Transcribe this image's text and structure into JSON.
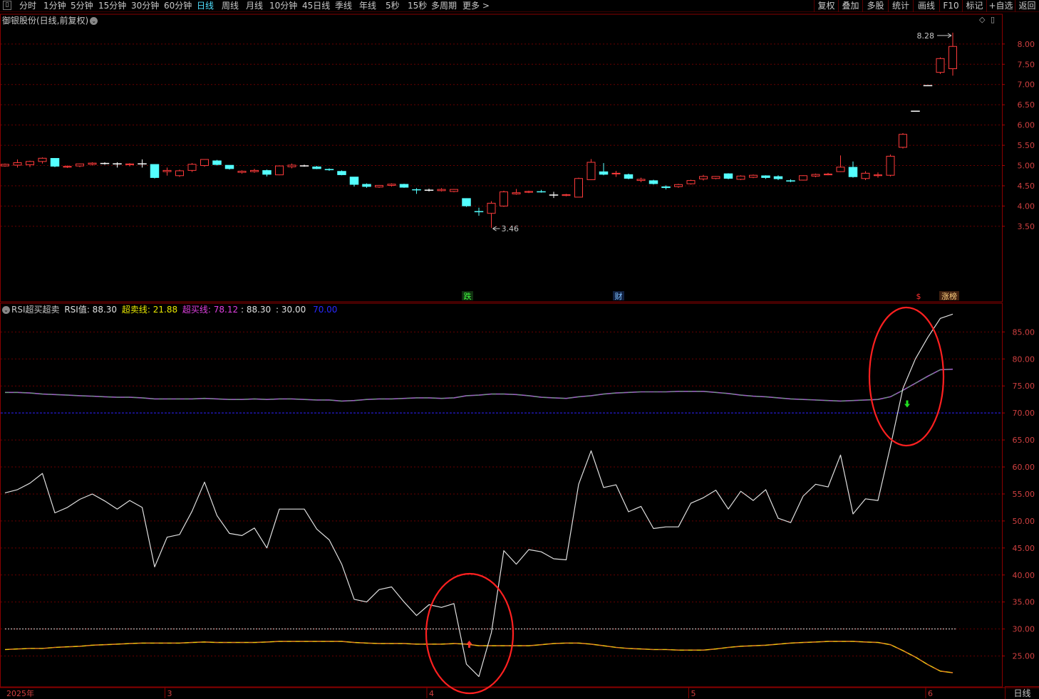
{
  "toolbar": {
    "first_icon": "▯",
    "periods": [
      "分时",
      "1分钟",
      "5分钟",
      "15分钟",
      "30分钟",
      "60分钟",
      "日线",
      "周线",
      "月线",
      "10分钟",
      "45日线",
      "季线",
      "年线",
      "5秒",
      "15秒",
      "多周期",
      "更多 >"
    ],
    "active": "日线",
    "right_buttons": [
      "复权",
      "叠加",
      "多股",
      "统计",
      "画线",
      "F10",
      "标记",
      "+自选",
      "返回"
    ]
  },
  "stock_title": "御银股份(日线,前复权)",
  "indicator": {
    "name": "RSI超买超卖",
    "rsi_label": "RSI值: 88.30",
    "oversold_label": "超卖线: 21.88",
    "overbought_label": "超买线: 78.12",
    "extra1": ": 88.30",
    "extra2": ": 30.00",
    "extra3": "70.00",
    "colors": {
      "rsi": "#e0e0e0",
      "oversold": "#e8e800",
      "overbought": "#e040e0",
      "line70": "#2020ff"
    }
  },
  "markers": {
    "fall": "跌",
    "fin": "财",
    "zt_icon": "$",
    "zt_list": "涨榜"
  },
  "period_box": "日线",
  "chart_data": [
    {
      "type": "candlestick",
      "title": "",
      "ylim": [
        3.3,
        8.4
      ],
      "yticks": [
        "8.00",
        "7.50",
        "7.00",
        "6.50",
        "6.00",
        "5.50",
        "5.00",
        "4.50",
        "4.00",
        "3.50"
      ],
      "annotations": {
        "high": "8.28",
        "low": "3.46"
      },
      "colors": {
        "up": "#ff3b3b",
        "down": "#54ffff",
        "flat": "#ffffff"
      },
      "ohlc": [
        [
          4.99,
          5.05,
          4.97,
          5.03
        ],
        [
          5.01,
          5.15,
          4.95,
          5.07
        ],
        [
          5.02,
          5.12,
          4.96,
          5.1
        ],
        [
          5.1,
          5.2,
          5.05,
          5.18
        ],
        [
          5.18,
          5.18,
          4.96,
          4.98
        ],
        [
          4.96,
          5.0,
          4.94,
          4.98
        ],
        [
          4.99,
          5.05,
          4.96,
          5.04
        ],
        [
          5.03,
          5.08,
          5.0,
          5.06
        ],
        [
          5.06,
          5.08,
          5.02,
          5.06
        ],
        [
          5.05,
          5.08,
          4.95,
          5.05
        ],
        [
          5.02,
          5.06,
          4.98,
          5.04
        ],
        [
          5.05,
          5.15,
          4.95,
          5.05
        ],
        [
          5.03,
          5.03,
          4.68,
          4.7
        ],
        [
          4.85,
          4.95,
          4.75,
          4.88
        ],
        [
          4.75,
          4.9,
          4.72,
          4.87
        ],
        [
          4.88,
          5.06,
          4.84,
          5.03
        ],
        [
          5.0,
          5.16,
          4.97,
          5.15
        ],
        [
          5.12,
          5.14,
          5.0,
          5.02
        ],
        [
          5.01,
          5.01,
          4.9,
          4.92
        ],
        [
          4.83,
          4.88,
          4.8,
          4.86
        ],
        [
          4.85,
          4.92,
          4.82,
          4.88
        ],
        [
          4.88,
          4.9,
          4.73,
          4.78
        ],
        [
          4.77,
          5.0,
          4.76,
          4.99
        ],
        [
          4.97,
          5.05,
          4.93,
          5.01
        ],
        [
          5.0,
          5.02,
          4.97,
          5.0
        ],
        [
          4.97,
          4.99,
          4.91,
          4.92
        ],
        [
          4.91,
          4.93,
          4.87,
          4.89
        ],
        [
          4.86,
          4.88,
          4.76,
          4.77
        ],
        [
          4.72,
          4.72,
          4.48,
          4.53
        ],
        [
          4.54,
          4.56,
          4.45,
          4.48
        ],
        [
          4.47,
          4.52,
          4.45,
          4.51
        ],
        [
          4.51,
          4.56,
          4.48,
          4.54
        ],
        [
          4.54,
          4.55,
          4.45,
          4.46
        ],
        [
          4.41,
          4.44,
          4.3,
          4.4
        ],
        [
          4.4,
          4.43,
          4.36,
          4.4
        ],
        [
          4.38,
          4.44,
          4.36,
          4.41
        ],
        [
          4.36,
          4.42,
          4.34,
          4.41
        ],
        [
          4.19,
          4.19,
          3.98,
          4.0
        ],
        [
          3.87,
          3.96,
          3.76,
          3.86
        ],
        [
          3.82,
          4.12,
          3.46,
          4.07
        ],
        [
          4.0,
          4.38,
          3.98,
          4.35
        ],
        [
          4.3,
          4.42,
          4.28,
          4.33
        ],
        [
          4.34,
          4.38,
          4.32,
          4.36
        ],
        [
          4.36,
          4.4,
          4.33,
          4.35
        ],
        [
          4.28,
          4.35,
          4.2,
          4.28
        ],
        [
          4.26,
          4.3,
          4.24,
          4.28
        ],
        [
          4.22,
          4.7,
          4.22,
          4.68
        ],
        [
          4.65,
          5.16,
          4.64,
          5.08
        ],
        [
          4.85,
          5.06,
          4.76,
          4.78
        ],
        [
          4.8,
          4.87,
          4.72,
          4.81
        ],
        [
          4.78,
          4.8,
          4.66,
          4.68
        ],
        [
          4.63,
          4.7,
          4.59,
          4.66
        ],
        [
          4.63,
          4.65,
          4.53,
          4.55
        ],
        [
          4.48,
          4.51,
          4.41,
          4.45
        ],
        [
          4.48,
          4.55,
          4.45,
          4.53
        ],
        [
          4.55,
          4.65,
          4.53,
          4.63
        ],
        [
          4.67,
          4.77,
          4.63,
          4.73
        ],
        [
          4.68,
          4.74,
          4.66,
          4.73
        ],
        [
          4.8,
          4.81,
          4.66,
          4.68
        ],
        [
          4.66,
          4.76,
          4.64,
          4.74
        ],
        [
          4.71,
          4.78,
          4.69,
          4.76
        ],
        [
          4.75,
          4.76,
          4.67,
          4.7
        ],
        [
          4.73,
          4.76,
          4.64,
          4.67
        ],
        [
          4.63,
          4.66,
          4.59,
          4.61
        ],
        [
          4.64,
          4.76,
          4.63,
          4.75
        ],
        [
          4.74,
          4.8,
          4.71,
          4.78
        ],
        [
          4.77,
          4.82,
          4.76,
          4.79
        ],
        [
          4.85,
          5.25,
          4.84,
          4.96
        ],
        [
          4.96,
          5.1,
          4.7,
          4.72
        ],
        [
          4.68,
          4.86,
          4.64,
          4.81
        ],
        [
          4.75,
          4.83,
          4.7,
          4.77
        ],
        [
          4.76,
          5.27,
          4.73,
          5.23
        ],
        [
          5.45,
          5.8,
          5.42,
          5.77
        ],
        [
          6.35,
          6.35,
          6.35,
          6.35
        ],
        [
          6.98,
          6.98,
          6.98,
          6.98
        ],
        [
          7.3,
          7.67,
          7.26,
          7.64
        ],
        [
          7.39,
          8.28,
          7.22,
          7.94
        ]
      ]
    },
    {
      "type": "line",
      "title": "",
      "ylim": [
        20,
        90
      ],
      "yticks": [
        "85.00",
        "80.00",
        "75.00",
        "70.00",
        "65.00",
        "60.00",
        "55.00",
        "50.00",
        "45.00",
        "40.00",
        "35.00",
        "30.00",
        "25.00"
      ],
      "x_labels": [
        "2025年",
        "3",
        "4",
        "5",
        "6"
      ],
      "series": [
        {
          "name": "RSI值",
          "values": [
            55.2,
            55.8,
            57.0,
            58.8,
            51.5,
            52.5,
            54.0,
            55.0,
            53.7,
            52.2,
            53.8,
            52.5,
            41.5,
            47.0,
            47.5,
            51.8,
            57.2,
            51.0,
            47.7,
            47.3,
            48.7,
            45.0,
            52.2,
            52.2,
            52.2,
            48.5,
            46.5,
            42.0,
            35.5,
            35.0,
            37.3,
            37.8,
            35.0,
            32.5,
            34.5,
            34.0,
            34.7,
            23.5,
            21.2,
            29.3,
            44.5,
            42.0,
            44.7,
            44.3,
            43.0,
            42.8,
            56.8,
            63.0,
            56.2,
            56.7,
            51.7,
            52.7,
            48.6,
            48.9,
            48.9,
            53.3,
            54.3,
            55.7,
            52.2,
            55.5,
            53.8,
            55.8,
            50.5,
            49.7,
            54.6,
            56.8,
            56.3,
            62.2,
            51.3,
            54.1,
            53.8,
            63.8,
            74.5,
            80.0,
            84.0,
            87.5,
            88.3
          ]
        },
        {
          "name": "超买线",
          "values": [
            73.8,
            73.8,
            73.7,
            73.5,
            73.4,
            73.3,
            73.2,
            73.1,
            73.0,
            72.9,
            72.9,
            72.8,
            72.6,
            72.6,
            72.6,
            72.6,
            72.7,
            72.6,
            72.5,
            72.5,
            72.6,
            72.5,
            72.6,
            72.6,
            72.5,
            72.4,
            72.4,
            72.2,
            72.3,
            72.5,
            72.6,
            72.6,
            72.7,
            72.8,
            72.8,
            72.7,
            72.8,
            73.2,
            73.3,
            73.5,
            73.5,
            73.4,
            73.2,
            72.9,
            72.8,
            72.7,
            73.0,
            73.2,
            73.5,
            73.7,
            73.8,
            73.9,
            73.9,
            73.9,
            74.0,
            74.0,
            74.0,
            73.8,
            73.6,
            73.3,
            73.1,
            73.0,
            72.8,
            72.6,
            72.5,
            72.4,
            72.3,
            72.2,
            72.3,
            72.4,
            72.5,
            73.0,
            74.2,
            75.5,
            76.8,
            78.0,
            78.1
          ]
        },
        {
          "name": "超卖线",
          "values": [
            26.2,
            26.3,
            26.4,
            26.4,
            26.6,
            26.7,
            26.8,
            27.0,
            27.1,
            27.2,
            27.3,
            27.4,
            27.4,
            27.4,
            27.4,
            27.5,
            27.6,
            27.5,
            27.5,
            27.5,
            27.5,
            27.6,
            27.7,
            27.7,
            27.7,
            27.7,
            27.7,
            27.7,
            27.5,
            27.4,
            27.3,
            27.3,
            27.3,
            27.2,
            27.2,
            27.2,
            27.3,
            27.2,
            26.9,
            26.9,
            26.9,
            26.9,
            26.9,
            27.1,
            27.3,
            27.4,
            27.4,
            27.2,
            26.9,
            26.6,
            26.4,
            26.3,
            26.2,
            26.2,
            26.1,
            26.1,
            26.1,
            26.3,
            26.6,
            26.8,
            26.9,
            27.0,
            27.2,
            27.4,
            27.5,
            27.6,
            27.7,
            27.7,
            27.7,
            27.6,
            27.5,
            27.1,
            26.0,
            24.8,
            23.4,
            22.2,
            21.9
          ]
        }
      ],
      "reference_lines": [
        {
          "value": 70,
          "label": "70.00"
        },
        {
          "value": 30,
          "label": "30.00"
        }
      ]
    }
  ]
}
